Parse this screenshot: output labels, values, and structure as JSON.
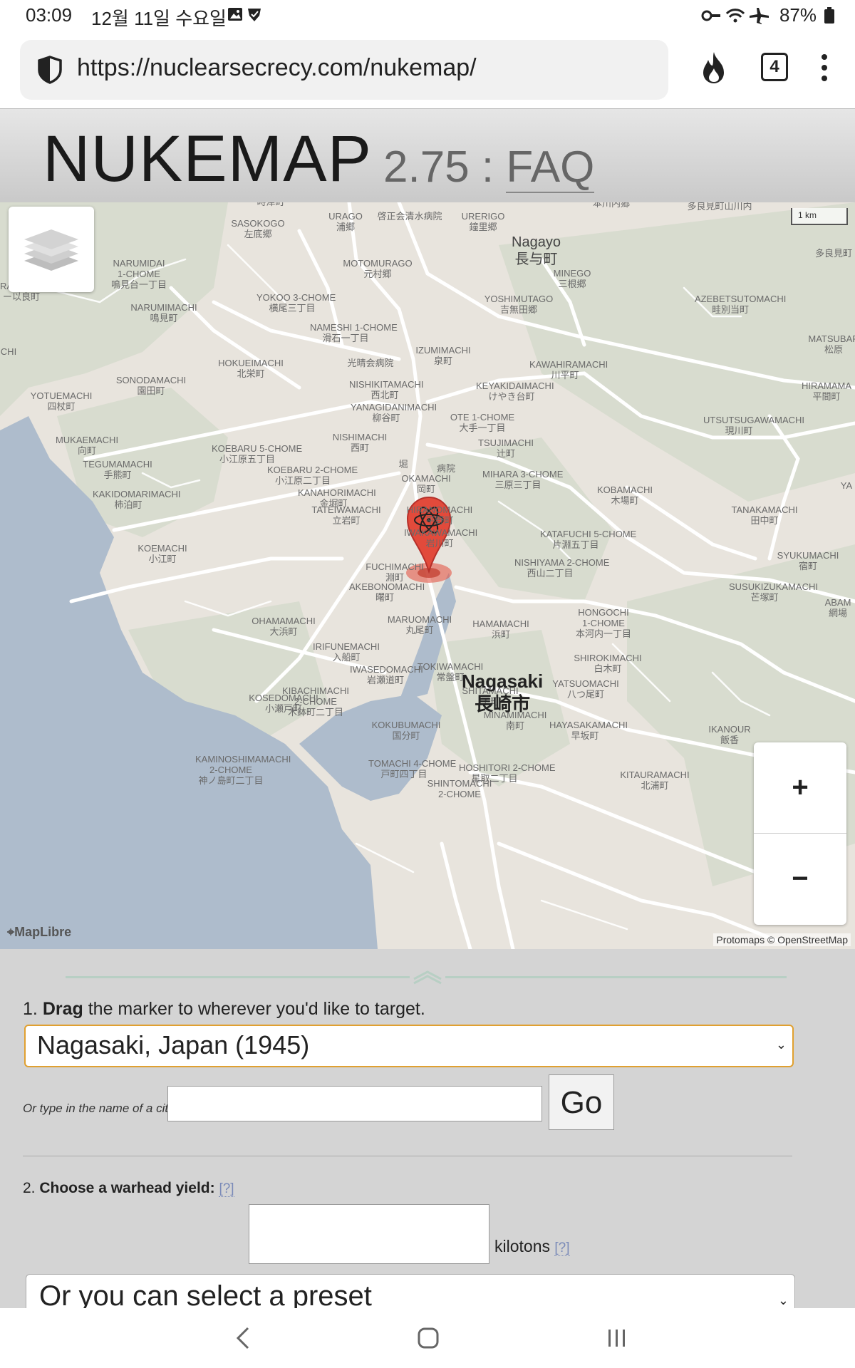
{
  "status_bar": {
    "time": "03:09",
    "date": "12월 11일 수요일",
    "battery": "87%"
  },
  "browser": {
    "url": "https://nuclearsecrecy.com/nukemap/",
    "tab_count": "4"
  },
  "header": {
    "title": "NUKEMAP",
    "version": "2.75 :",
    "faq_link": "FAQ"
  },
  "map": {
    "city_label": "Nagasaki\n長崎市",
    "town_label": "Nagayo\n長与町",
    "scale": "1 km",
    "maplibre_label": "MapLibre",
    "attribution": "Protomaps © OpenStreetMap",
    "zoom_in": "+",
    "zoom_out": "−",
    "district_labels": [
      "時津町",
      "URAGO\n浦郷",
      "啓正会清水病院",
      "URERIGO\n鐘里郷",
      "本川内郷",
      "多良見町山川内",
      "SASOKOGO\n左底郷",
      "NARUMIDAI\n1-CHOME\n鳴見台一丁目",
      "RAMACHI\nー以良町",
      "MOTOMURAGO\n元村郷",
      "MINEGO\n三根郷",
      "多良見町",
      "YOKOO 3-CHOME\n横尾三丁目",
      "NARUMIMACHI\n鳴見町",
      "YOSHIMUTAGO\n吉無田郷",
      "AZEBETSUTOMACHI\n畦別当町",
      "NAMESHI 1-CHOME\n滑石一丁目",
      "MATSUBAR\n松原",
      "CHI",
      "IZUMIMACHI\n泉町",
      "HOKUEIMACHI\n北栄町",
      "光晴会病院",
      "KAWAHIRAMACHI\n川平町",
      "SONODAMACHI\n園田町",
      "NISHIKITAMACHI\n西北町",
      "KEYAKIDAIMACHI\nけやき台町",
      "HIRAMAMA\n平間町",
      "YOTUEMACHI\n四杖町",
      "YANAGIDANIMACHI\n柳谷町",
      "OTE 1-CHOME\n大手一丁目",
      "UTSUTSUGAWAMACHI\n現川町",
      "MUKAEMACHI\n向町",
      "NISHIMACHI\n西町",
      "TSUJIMACHI\n辻町",
      "KOEBARU 5-CHOME\n小江原五丁目",
      "TEGUMAMACHI\n手熊町",
      "KOEBARU 2-CHOME\n小江原二丁目",
      "MIHARA 3-CHOME\n三原三丁目",
      "YA",
      "OKAMACHI\n岡町",
      "KOBAMACHI\n木場町",
      "KAKIDOMARIMACHI\n柿泊町",
      "KANAHORIMACHI\n金堀町",
      "TANAKAMACHI\n田中町",
      "HIRANOMACHI\n平野町",
      "TATEIWAMACHI\n立岩町",
      "IWAKAWAMACHI\n岩川町",
      "KATAFUCHI 5-CHOME\n片淵五丁目",
      "KOEMACHI\n小江町",
      "SYUKUMACHI\n宿町",
      "NISHIYAMA 2-CHOME\n西山二丁目",
      "FUCHIMACHI\n淵町",
      "SUSUKIZUKAMACHI\n芒塚町",
      "AKEBONOMACHI\n曙町",
      "ABAM\n網場",
      "HONGOCHI\n1-CHOME\n本河内一丁目",
      "OHAMAMACHI\n大浜町",
      "MARUOMACHI\n丸尾町",
      "HAMAMACHI\n浜町",
      "IRIFUNEMACHI\n入船町",
      "SHIROKIMACHI\n白木町",
      "TOKIWAMACHI\n常盤町",
      "IWASEDOMACHI\n岩瀬道町",
      "YATSUOMACHI\n八つ尾町",
      "SHITAMACHI\n下町",
      "KIBACHIMACHI\n2-CHOME\n木鉢町二丁目",
      "MINAMIMACHI\n南町",
      "HAYASAKAMACHI\n早坂町",
      "IKANOUR\n飯香",
      "KOSEDOMACHI\n小瀬戸町",
      "KOKUBUMACHI\n国分町",
      "KAMINOSHIMAMACHI\n2-CHOME\n神ノ島町二丁目",
      "TOMACHI 4-CHOME\n戸町四丁目",
      "HOSHITORI 2-CHOME\n星取二丁目",
      "KITAURAMACHI\n北浦町",
      "SHINTOMACHI\n2-CHOME",
      "堀",
      "病院"
    ]
  },
  "panel": {
    "step1_number": "1.",
    "step1_bold": "Drag",
    "step1_text": " the marker to wherever you'd like to target.",
    "city_select_value": "Nagasaki, Japan (1945)",
    "or_type_label": "Or type in the name of a city:",
    "go_button": "Go",
    "step2_number": "2.",
    "step2_bold": "Choose a warhead yield:",
    "help_link": "[?]",
    "kilotons_label": "kilotons",
    "preset_select_value": "Or you can select a preset"
  },
  "colors": {
    "land": "#e8e4dd",
    "water": "#aebccc",
    "park": "#d7dccf",
    "road": "#ffffff",
    "marker": "#e24a3b",
    "select_border": "#e0a030"
  }
}
